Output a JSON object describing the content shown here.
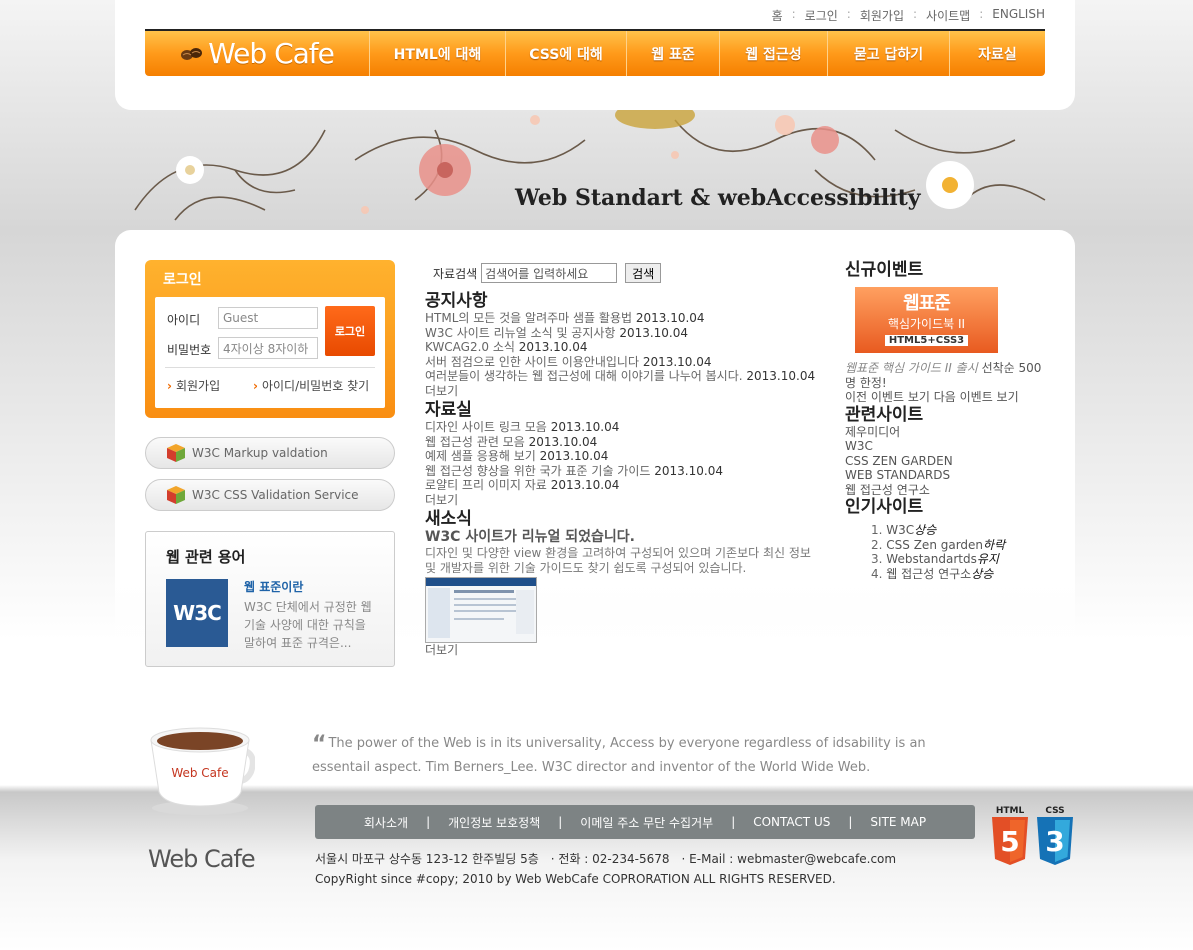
{
  "util_nav": [
    "홈",
    "로그인",
    "회원가입",
    "사이트맵",
    "ENGLISH"
  ],
  "gnb": {
    "logo": "Web Cafe",
    "menu": [
      "HTML에 대해",
      "CSS에 대해",
      "웹 표준",
      "웹 접근성",
      "묻고 답하기",
      "자료실"
    ]
  },
  "banner": {
    "title": "Web Standart & webAccessibility"
  },
  "login": {
    "title": "로그인",
    "id_label": "아이디",
    "id_value": "Guest",
    "pw_label": "비밀번호",
    "pw_value": "4자이상 8자이하",
    "button": "로그인",
    "link_join": "회원가입",
    "link_find": "아이디/비밀번호 찾기"
  },
  "validators": [
    "W3C Markup valdation",
    "W3C CSS Validation Service"
  ],
  "terms": {
    "title": "웹 관련 용어",
    "thumb": "W3C",
    "head": "웹 표준이란",
    "desc": "W3C 단체에서 규정한 웹 기술 사양에 대한 규칙을 말하여 표준 규격은..."
  },
  "search": {
    "label": "자료검색",
    "placeholder": "검색어를 입력하세요",
    "button": "검색"
  },
  "notice": {
    "title": "공지사항",
    "items": [
      {
        "text": "HTML의 모든 것을 알려주마 샘플 활용법",
        "date": "2013.10.04"
      },
      {
        "text": "W3C 사이트 리뉴얼 소식 및 공지사항",
        "date": "2013.10.04"
      },
      {
        "text": "KWCAG2.0 소식",
        "date": "2013.10.04"
      },
      {
        "text": "서버 점검으로 인한 사이트 이용안내입니다",
        "date": "2013.10.04"
      },
      {
        "text": "여러분들이 생각하는 웹 접근성에 대해 이야기를 나누어 봅시다.",
        "date": "2013.10.04"
      }
    ],
    "more": "더보기"
  },
  "archive": {
    "title": "자료실",
    "items": [
      {
        "text": "디자인 사이트 링크 모음",
        "date": "2013.10.04"
      },
      {
        "text": "웹 접근성 관련 모음",
        "date": "2013.10.04"
      },
      {
        "text": "예제 샘플 응용해 보기",
        "date": "2013.10.04"
      },
      {
        "text": "웹 접근성 향상을 위한 국가 표준 기술 가이드",
        "date": "2013.10.04"
      },
      {
        "text": "로얄티 프리 이미지 자료",
        "date": "2013.10.04"
      }
    ],
    "more": "더보기"
  },
  "news": {
    "title": "새소식",
    "headline": "W3C 사이트가 리뉴얼 되었습니다.",
    "desc": "디자인 및 다양한 view 환경을 고려하여 구성되어 있으며 기존보다 최신 정보 및 개발자를 위한 기술 가이드도 찾기 쉽도록 구성되어 있습니다.",
    "more": "더보기"
  },
  "event": {
    "title": "신규이벤트",
    "book_title": "웹표준",
    "book_sub": "핵심가이드북 II",
    "book_tag": "HTML5+CSS3",
    "text_em": "웹표준 핵심 가이드 II 출시",
    "text": " 선착순 500명 한정!",
    "nav": "이전 이벤트 보기 다음 이벤트 보기"
  },
  "related": {
    "title": "관련사이트",
    "items": [
      "제우미디어",
      "W3C",
      "CSS ZEN GARDEN",
      "WEB STANDARDS",
      "웹 접근성 연구소"
    ]
  },
  "popular": {
    "title": "인기사이트",
    "items": [
      {
        "num": "1.",
        "name": "W3C",
        "stat": "상승"
      },
      {
        "num": "2.",
        "name": "CSS Zen garden",
        "stat": "하락"
      },
      {
        "num": "3.",
        "name": "Webstandartds",
        "stat": "유지"
      },
      {
        "num": "4.",
        "name": "웹 접근성 연구소",
        "stat": "상승"
      }
    ]
  },
  "footer": {
    "cup_label": "Web Cafe",
    "quote_mark": "“",
    "quote_main": "The power of the Web is in its universality, Access by everyone regardless of idsability is an essentail aspect.",
    "quote_author": " Tim Berners_Lee. W3C director and inventor of the World Wide Web.",
    "nav": [
      "회사소개",
      "개인정보 보호정책",
      "이메일 주소 무단 수집거부",
      "CONTACT US",
      "SITE MAP"
    ],
    "logo": "Web Cafe",
    "address": "서울시 마포구 상수동 123-12 한주빌딩 5층",
    "phone": "· 전화 : 02-234-5678",
    "email": "· E-Mail : webmaster@webcafe.com",
    "copyright": "CopyRight since #copy; 2010 by Web WebCafe COPRORATION ALL RIGHTS RESERVED.",
    "badge_html": "HTML",
    "badge_css": "CSS",
    "badge_html_num": "5",
    "badge_css_num": "3"
  },
  "colors": {
    "accent": "#f98e12",
    "nav_bg": "#7d8384",
    "link_blue": "#1f63a8"
  }
}
